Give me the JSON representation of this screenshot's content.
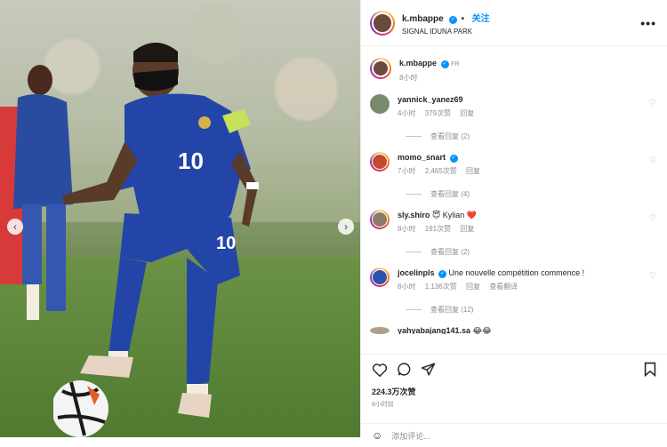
{
  "post": {
    "username": "k.mbappe",
    "follow_label": "关注",
    "location": "SIGNAL IDUNA PARK",
    "more_label": "•••"
  },
  "caption": {
    "username": "k.mbappe",
    "flag": "FR",
    "time": "8小时"
  },
  "comments": [
    {
      "username": "yannick_yanez69",
      "verified": false,
      "text": "",
      "time": "4小时",
      "likes": "379次赞",
      "reply_label": "回复",
      "view_replies": "查看回复 (2)",
      "avatar_color": "#7a8a6b"
    },
    {
      "username": "momo_snart",
      "verified": true,
      "text": "",
      "time": "7小时",
      "likes": "2,465次赞",
      "reply_label": "回复",
      "view_replies": "查看回复 (4)",
      "avatar_color": "#c04a2b"
    },
    {
      "username": "sly.shiro",
      "verified": false,
      "text": "😇 Kylian ❤️",
      "time": "8小时",
      "likes": "191次赞",
      "reply_label": "回复",
      "view_replies": "查看回复 (2)",
      "avatar_color": "#8b7a6a"
    },
    {
      "username": "jocelinpls",
      "verified": true,
      "text": "Une nouvelle compétition commence !",
      "time": "8小时",
      "likes": "1,136次赞",
      "reply_label": "回复",
      "translate_label": "查看翻译",
      "view_replies": "查看回复 (12)",
      "avatar_color": "#2b55a8"
    }
  ],
  "partial_comment": "yahyabajang141.sa 😂😂",
  "likes_count": "224.3万次赞",
  "post_time": "8小时前",
  "add_comment_placeholder": "添加评论...",
  "nav": {
    "prev": "‹",
    "next": "›"
  },
  "colors": {
    "accent": "#0095f6",
    "france_blue": "#2445a8"
  }
}
